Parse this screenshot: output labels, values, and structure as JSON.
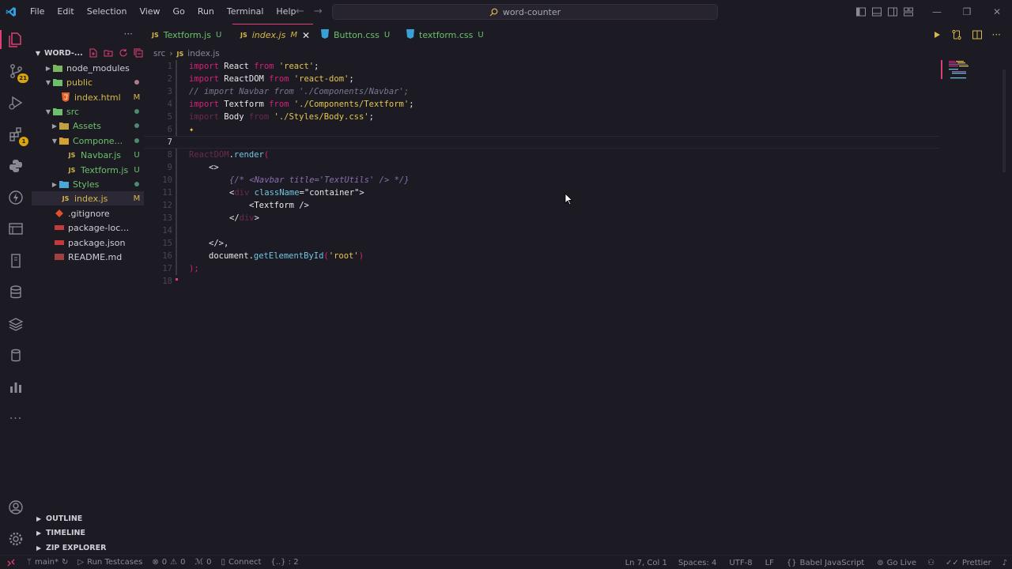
{
  "titlebar": {
    "menu": [
      "File",
      "Edit",
      "Selection",
      "View",
      "Go",
      "Run",
      "Terminal",
      "Help"
    ],
    "search_text": "word-counter"
  },
  "sidebar": {
    "project": "WORD-...",
    "items": [
      {
        "label": "node_modules",
        "type": "folder",
        "depth": 1,
        "expanded": false,
        "status": "",
        "color": "#cfcfd6"
      },
      {
        "label": "public",
        "type": "folder",
        "depth": 1,
        "expanded": true,
        "status": "dot",
        "color": "#d6b84a"
      },
      {
        "label": "index.html",
        "type": "html",
        "depth": 2,
        "status": "M",
        "color": "#d6b84a"
      },
      {
        "label": "src",
        "type": "folder",
        "depth": 1,
        "expanded": true,
        "status": "dot-green",
        "color": "#6cc06c"
      },
      {
        "label": "Assets",
        "type": "folder",
        "depth": 2,
        "expanded": false,
        "status": "dot-green",
        "color": "#6cc06c"
      },
      {
        "label": "Compone...",
        "type": "folder",
        "depth": 2,
        "expanded": true,
        "status": "dot-green",
        "color": "#6cc06c"
      },
      {
        "label": "Navbar.js",
        "type": "js",
        "depth": 3,
        "status": "U",
        "color": "#6cc06c"
      },
      {
        "label": "Textform.js",
        "type": "js",
        "depth": 3,
        "status": "U",
        "color": "#6cc06c"
      },
      {
        "label": "Styles",
        "type": "folder",
        "depth": 2,
        "expanded": false,
        "status": "dot-green",
        "color": "#6cc06c"
      },
      {
        "label": "index.js",
        "type": "js",
        "depth": 2,
        "status": "M",
        "color": "#d6b84a"
      },
      {
        "label": ".gitignore",
        "type": "git",
        "depth": 1,
        "status": "",
        "color": "#cfcfd6"
      },
      {
        "label": "package-lock.json",
        "type": "npm",
        "depth": 1,
        "status": "",
        "color": "#cfcfd6"
      },
      {
        "label": "package.json",
        "type": "npm",
        "depth": 1,
        "status": "",
        "color": "#cfcfd6"
      },
      {
        "label": "README.md",
        "type": "md",
        "depth": 1,
        "status": "",
        "color": "#cfcfd6"
      }
    ],
    "sections": [
      "OUTLINE",
      "TIMELINE",
      "ZIP EXPLORER"
    ]
  },
  "tabs": [
    {
      "label": "Textform.js",
      "icon": "JS",
      "mod": "U",
      "active": false
    },
    {
      "label": "index.js",
      "icon": "JS",
      "mod": "M",
      "active": true
    },
    {
      "label": "Button.css",
      "icon": "css",
      "mod": "U",
      "active": false
    },
    {
      "label": "textform.css",
      "icon": "css",
      "mod": "U",
      "active": false
    }
  ],
  "breadcrumb": [
    "src",
    "index.js"
  ],
  "activity_badges": {
    "source_control": "21",
    "extensions": "1"
  },
  "statusbar": {
    "branch": "main*",
    "run_testcases": "Run Testcases",
    "errors": "0",
    "warnings": "0",
    "ports": "0",
    "connect": "Connect",
    "selection": "{..} : 2",
    "position": "Ln 7, Col 1",
    "spaces": "Spaces: 4",
    "encoding": "UTF-8",
    "eol": "LF",
    "language": "Babel JavaScript",
    "golive": "Go Live",
    "prettier": "Prettier"
  },
  "code": {
    "l1": {
      "kw": "import",
      "id": "React",
      "from": "from",
      "str": "'react'",
      "end": ";"
    },
    "l2": {
      "kw": "import",
      "id": "ReactDOM",
      "from": "from",
      "str": "'react-dom'",
      "end": ";"
    },
    "l3": "// import Navbar from './Components/Navbar';",
    "l4": {
      "kw": "import",
      "id": "Textform",
      "from": "from",
      "str": "'./Components/Textform'",
      "end": ";"
    },
    "l5": {
      "kw": "import",
      "id": "Body",
      "from": "from",
      "str": "'./Styles/Body.css'",
      "end": ";"
    },
    "l8": {
      "obj": "ReactDOM",
      "dot": ".",
      "fn": "render",
      "open": "("
    },
    "l9": "<>",
    "l10": "{/* <Navbar title='TextUtils' /> */}",
    "l11": {
      "open": "<",
      "tag": "div",
      "attr": "className",
      "eq": "=",
      "val": "\"container\"",
      "close": ">"
    },
    "l12": "<Textform />",
    "l13": {
      "open": "</",
      "tag": "div",
      "close": ">"
    },
    "l15": "</>,",
    "l16": {
      "id": "document",
      "dot": ".",
      "fn": "getElementById",
      "open": "(",
      "str": "'root'",
      "close": ")"
    },
    "l17": ");"
  }
}
